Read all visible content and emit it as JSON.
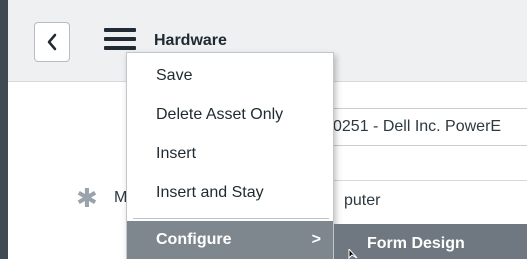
{
  "header": {
    "back_icon": "chevron-left-icon",
    "menu_icon": "hamburger-menu-icon",
    "title": "Hardware"
  },
  "form": {
    "field_value_partial": "0251 - Dell Inc. PowerE",
    "required_field_label_partial": "M",
    "required_field_value_partial": "puter",
    "required_icon": "asterisk-icon"
  },
  "context_menu": {
    "items": [
      {
        "label": "Save"
      },
      {
        "label": "Delete Asset Only"
      },
      {
        "label": "Insert"
      },
      {
        "label": "Insert and Stay"
      },
      {
        "label": "Configure",
        "arrow": ">"
      }
    ]
  },
  "submenu": {
    "items": [
      {
        "label": "Form Design"
      }
    ]
  },
  "colors": {
    "header_bg": "#eef0f2",
    "menu_highlight": "#7f878e",
    "submenu_bg": "#6f7880",
    "left_bar": "#3f4a53"
  }
}
